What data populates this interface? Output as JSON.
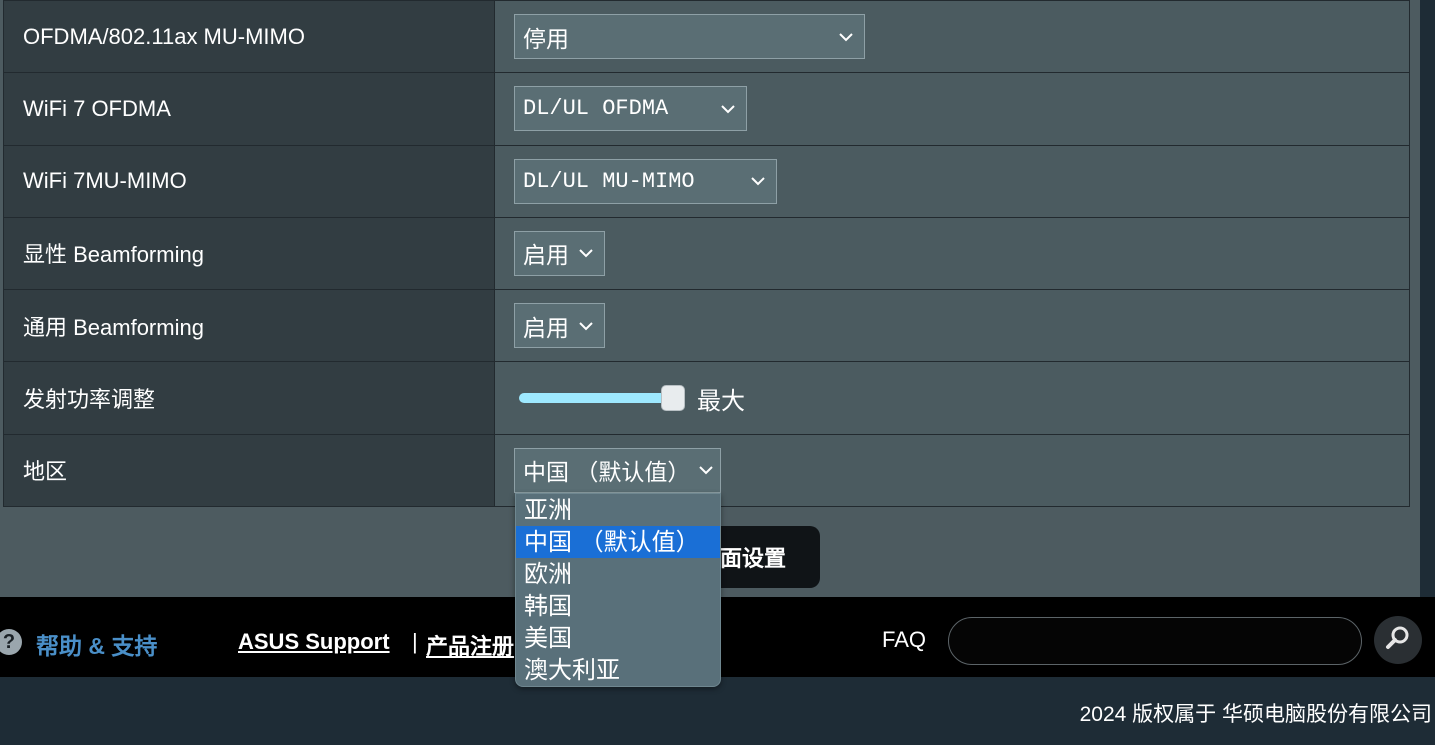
{
  "settings": {
    "rows": [
      {
        "label": "OFDMA/802.11ax MU-MIMO",
        "value": "停用"
      },
      {
        "label": "WiFi 7 OFDMA",
        "value": "DL/UL OFDMA"
      },
      {
        "label": "WiFi 7MU-MIMO",
        "value": "DL/UL MU-MIMO"
      },
      {
        "label": "显性 Beamforming",
        "value": "启用"
      },
      {
        "label": "通用 Beamforming",
        "value": "启用"
      },
      {
        "label": "发射功率调整",
        "value": "最大",
        "level": 1.0
      },
      {
        "label": "地区",
        "value": "中国 （默认值）"
      }
    ]
  },
  "region_dropdown": {
    "options": [
      "亚洲",
      "中国 （默认值）",
      "欧洲",
      "韩国",
      "美国",
      "澳大利亚"
    ],
    "selected": "中国 （默认值）"
  },
  "apply_button": {
    "label": "面设置"
  },
  "footer": {
    "help_icon": "question-icon",
    "help_label": "帮助 & 支持",
    "support_link": "ASUS Support",
    "separator": "|",
    "register_link": "产品注册",
    "faq_label": "FAQ",
    "faq_value": "",
    "search_icon": "search-icon",
    "copyright": "2024 版权属于 华硕电脑股份有限公司"
  },
  "colors": {
    "slider_track": "#9ee9ff",
    "dropdown_selected": "#1a6fd6",
    "help_label": "#4a8fc8"
  }
}
